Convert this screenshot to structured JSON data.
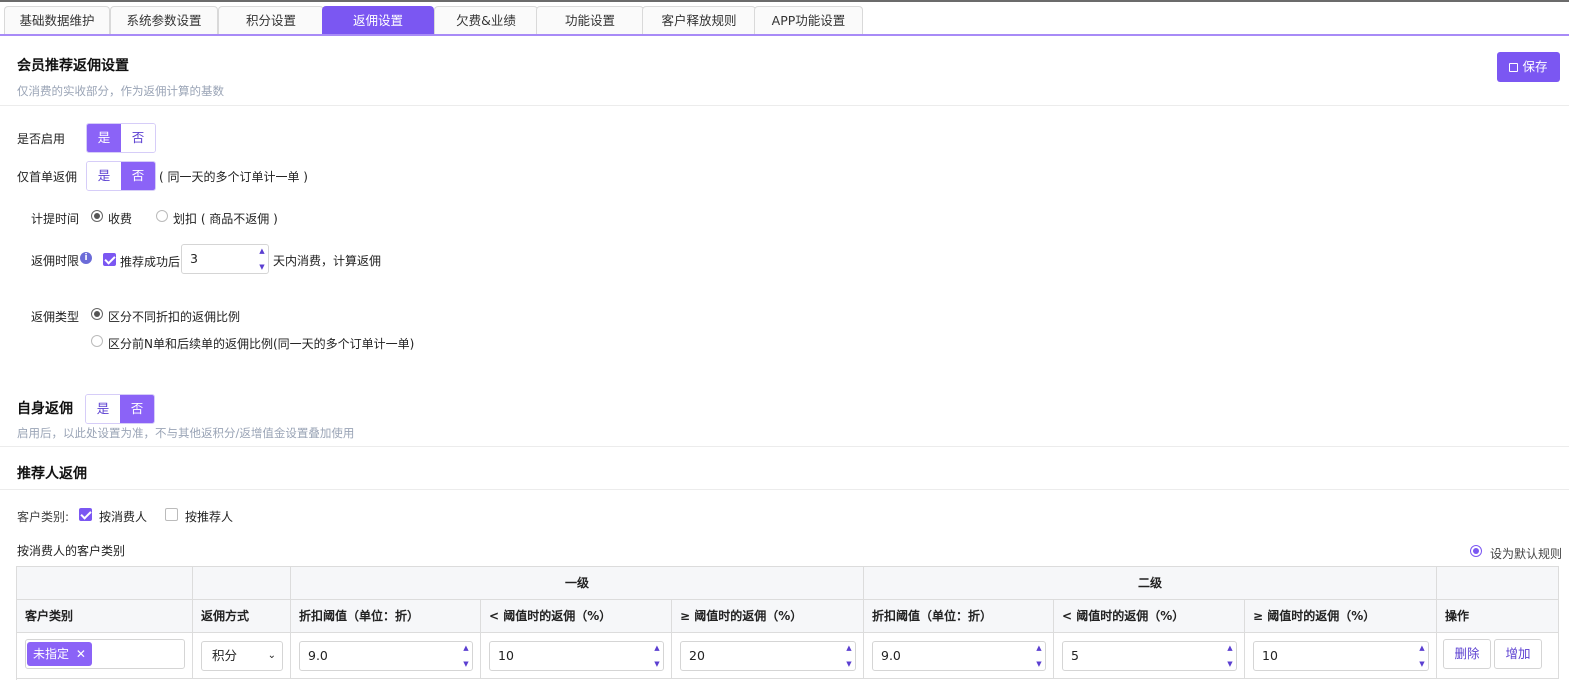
{
  "tabs": [
    {
      "label": "基础数据维护"
    },
    {
      "label": "系统参数设置"
    },
    {
      "label": "积分设置"
    },
    {
      "label": "返佣设置"
    },
    {
      "label": "欠费&业绩"
    },
    {
      "label": "功能设置"
    },
    {
      "label": "客户释放规则"
    },
    {
      "label": "APP功能设置"
    }
  ],
  "member_section": {
    "title": "会员推荐返佣设置",
    "subtitle": "仅消费的实收部分，作为返佣计算的基数",
    "save_label": "保存",
    "enable_label": "是否启用",
    "yes": "是",
    "no": "否",
    "first_order_label": "仅首单返佣",
    "first_order_note": "( 同一天的多个订单计一单 )",
    "calc_time_label": "计提时间",
    "calc_opt1": "收费",
    "calc_opt2": "划扣 ( 商品不返佣 )",
    "limit_label": "返佣时限",
    "limit_check_label": "推荐成功后",
    "limit_days": "3",
    "limit_suffix": "天内消费，计算返佣",
    "type_label": "返佣类型",
    "type_opt1": "区分不同折扣的返佣比例",
    "type_opt2": "区分前N单和后续单的返佣比例(同一天的多个订单计一单)"
  },
  "self_section": {
    "title": "自身返佣",
    "yes": "是",
    "no": "否",
    "subtitle": "启用后，以此处设置为准，不与其他返积分/返增值金设置叠加使用"
  },
  "referrer_section": {
    "title": "推荐人返佣",
    "category_label": "客户类别:",
    "by_consumer": "按消费人",
    "by_referrer": "按推荐人",
    "table_title": "按消费人的客户类别",
    "default_rule": "设为默认规则"
  },
  "table": {
    "group1": "一级",
    "group2": "二级",
    "headers": [
      "客户类别",
      "返佣方式",
      "折扣阈值（单位：折）",
      "< 阈值时的返佣（%）",
      "≥ 阈值时的返佣（%）",
      "折扣阈值（单位：折）",
      "< 阈值时的返佣（%）",
      "≥ 阈值时的返佣（%）",
      "操作"
    ],
    "row": {
      "tag": "未指定",
      "method": "积分",
      "l1_threshold": "9.0",
      "l1_below": "10",
      "l1_above": "20",
      "l2_threshold": "9.0",
      "l2_below": "5",
      "l2_above": "10",
      "delete": "删除",
      "add": "增加"
    }
  }
}
